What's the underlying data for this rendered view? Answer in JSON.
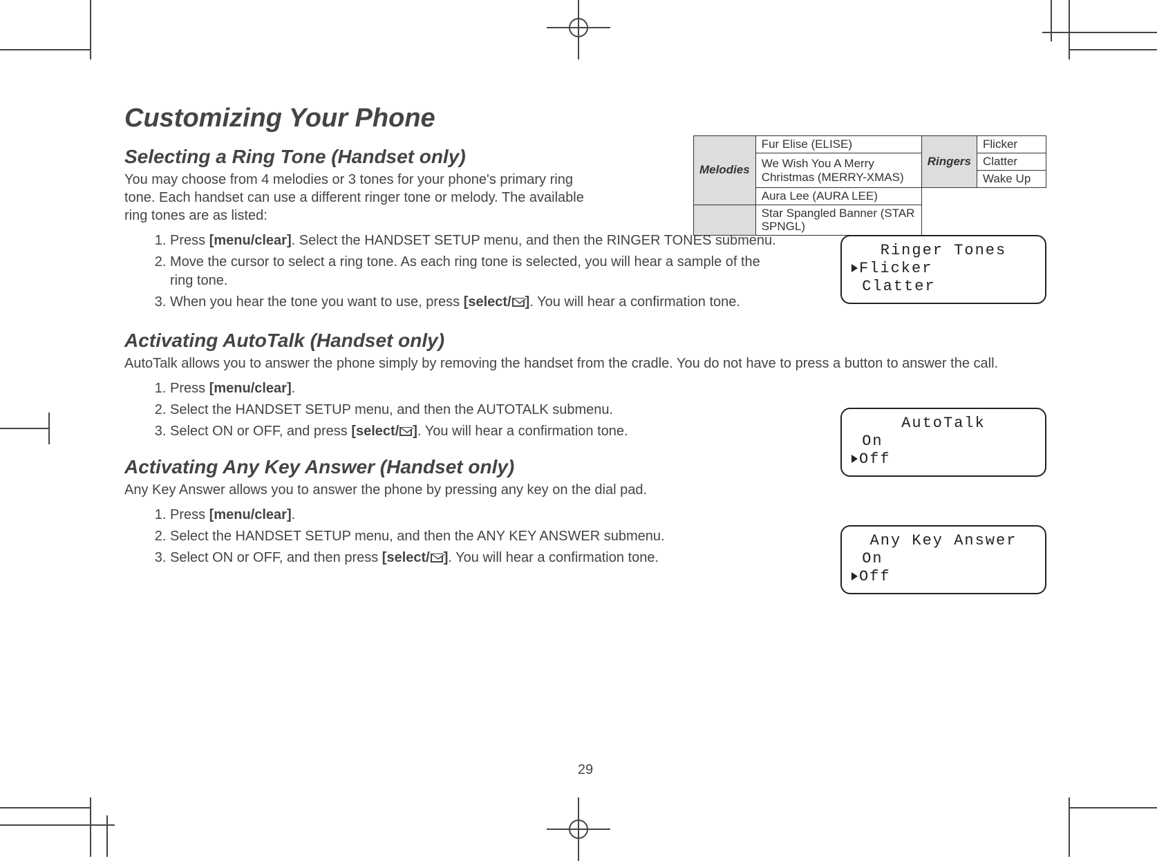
{
  "title": "Customizing Your Phone",
  "page_number": "29",
  "ringtone": {
    "heading": "Selecting a Ring Tone (Handset only)",
    "intro": "You may choose from 4 melodies or 3 tones for your phone's primary ring tone. Each handset can use a different ringer tone or melody. The available ring tones are as listed:",
    "table": {
      "melodies_header": "Melodies",
      "ringers_header": "Ringers",
      "melodies": [
        "Fur Elise (ELISE)",
        "We Wish You A Merry Christmas (MERRY-XMAS)",
        "Aura Lee (AURA LEE)",
        "Star Spangled Banner (STAR SPNGL)"
      ],
      "ringers": [
        "Flicker",
        "Clatter",
        "Wake Up"
      ]
    },
    "steps": {
      "s1a": "Press ",
      "s1b": "[menu/clear]",
      "s1c": ". Select the HANDSET SETUP menu, and then the RINGER TONES submenu.",
      "s2": "Move the cursor to select a ring tone. As each ring tone is selected, you will hear a sample of the ring tone.",
      "s3a": "When you hear the tone you want to use, press ",
      "s3b": "[select/",
      "s3c": "]",
      "s3d": ". You will hear a confirmation tone."
    },
    "lcd": {
      "title": "Ringer Tones",
      "line1": "Flicker",
      "line2": "Clatter"
    }
  },
  "autotalk": {
    "heading": "Activating AutoTalk (Handset only)",
    "intro": "AutoTalk allows you to answer the phone simply by removing the handset from the cradle. You do not have to press a button to answer the call.",
    "steps": {
      "s1a": "Press ",
      "s1b": "[menu/clear]",
      "s1c": ".",
      "s2": "Select the HANDSET SETUP menu, and then the AUTOTALK submenu.",
      "s3a": "Select ON or OFF, and press ",
      "s3b": "[select/",
      "s3c": "]",
      "s3d": ". You will hear a confirmation tone."
    },
    "lcd": {
      "title": "AutoTalk",
      "line1": "On",
      "line2": "Off"
    }
  },
  "anykey": {
    "heading": "Activating Any Key Answer (Handset only)",
    "intro": "Any Key Answer allows you to answer the phone by pressing any key on the dial pad.",
    "steps": {
      "s1a": "Press ",
      "s1b": "[menu/clear]",
      "s1c": ".",
      "s2": "Select the HANDSET SETUP menu, and then the ANY KEY ANSWER submenu.",
      "s3a": "Select ON or OFF, and then press ",
      "s3b": "[select/",
      "s3c": "]",
      "s3d": ". You will hear a confirmation tone."
    },
    "lcd": {
      "title": "Any Key Answer",
      "line1": "On",
      "line2": "Off"
    }
  }
}
